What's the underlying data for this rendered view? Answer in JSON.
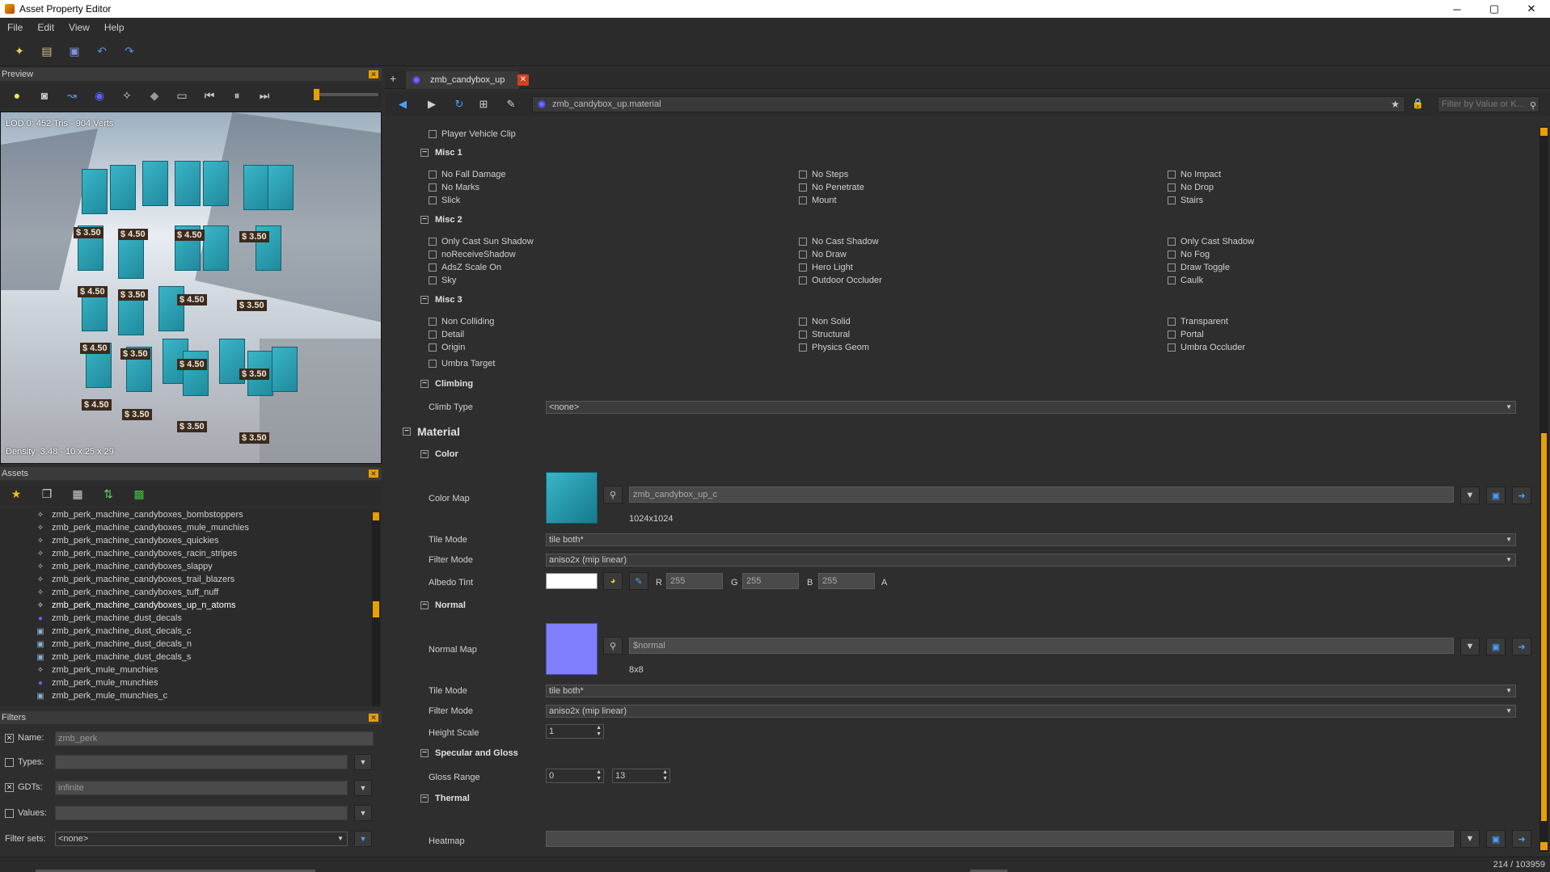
{
  "window": {
    "title": "Asset Property Editor",
    "controls": [
      "─",
      "▢",
      "✕"
    ]
  },
  "menu": [
    "File",
    "Edit",
    "View",
    "Help"
  ],
  "panels": {
    "preview": "Preview",
    "assets": "Assets",
    "filters": "Filters"
  },
  "preview": {
    "lod_stat": "LOD 0: 452 Tris - 904 Verts",
    "density": "Density: 3.48 - 10 x 25 x 29",
    "prices": [
      "$ 3.50",
      "$ 4.50",
      "$ 4.50",
      "$ 3.50",
      "$ 4.50",
      "$ 3.50",
      "$ 4.50",
      "$ 3.50",
      "$ 4.50",
      "$ 3.50",
      "$ 4.50",
      "$ 3.50",
      "$ 4.50",
      "$ 3.50",
      "$ 3.50",
      "$ 3.50"
    ]
  },
  "assets": [
    {
      "name": "zmb_perk_machine_candyboxes_bombstoppers",
      "icon": "model"
    },
    {
      "name": "zmb_perk_machine_candyboxes_mule_munchies",
      "icon": "model"
    },
    {
      "name": "zmb_perk_machine_candyboxes_quickies",
      "icon": "model"
    },
    {
      "name": "zmb_perk_machine_candyboxes_racin_stripes",
      "icon": "model"
    },
    {
      "name": "zmb_perk_machine_candyboxes_slappy",
      "icon": "model"
    },
    {
      "name": "zmb_perk_machine_candyboxes_trail_blazers",
      "icon": "model"
    },
    {
      "name": "zmb_perk_machine_candyboxes_tuff_nuff",
      "icon": "model"
    },
    {
      "name": "zmb_perk_machine_candyboxes_up_n_atoms",
      "icon": "model"
    },
    {
      "name": "zmb_perk_machine_dust_decals",
      "icon": "material"
    },
    {
      "name": "zmb_perk_machine_dust_decals_c",
      "icon": "image"
    },
    {
      "name": "zmb_perk_machine_dust_decals_n",
      "icon": "image"
    },
    {
      "name": "zmb_perk_machine_dust_decals_s",
      "icon": "image"
    },
    {
      "name": "zmb_perk_mule_munchies",
      "icon": "model"
    },
    {
      "name": "zmb_perk_mule_munchies",
      "icon": "material"
    },
    {
      "name": "zmb_perk_mule_munchies_c",
      "icon": "image"
    }
  ],
  "filters": {
    "name_label": "Name:",
    "name_value": "zmb_perk",
    "name_checked": "✕",
    "types_label": "Types:",
    "types_value": "",
    "gdts_label": "GDTs:",
    "gdts_value": "infinite",
    "gdts_checked": "✕",
    "values_label": "Values:",
    "values_value": "",
    "sets_label": "Filter sets:",
    "sets_value": "<none>"
  },
  "tab": {
    "add": "+",
    "label": "zmb_candybox_up",
    "close": "✕"
  },
  "address": {
    "path": "zmb_candybox_up.material",
    "filter_placeholder": "Filter by Value or K..."
  },
  "props": {
    "player_vehicle_clip": "Player Vehicle Clip",
    "misc1": {
      "title": "Misc 1",
      "col1": [
        "No Fall Damage",
        "No Marks",
        "Slick"
      ],
      "col2": [
        "No Steps",
        "No Penetrate",
        "Mount"
      ],
      "col3": [
        "No Impact",
        "No Drop",
        "Stairs"
      ]
    },
    "misc2": {
      "title": "Misc 2",
      "col1": [
        "Only Cast Sun Shadow",
        "noReceiveShadow",
        "AdsZ Scale On",
        "Sky"
      ],
      "col2": [
        "No Cast Shadow",
        "No Draw",
        "Hero Light",
        "Outdoor Occluder"
      ],
      "col3": [
        "Only Cast Shadow",
        "No Fog",
        "Draw Toggle",
        "Caulk"
      ]
    },
    "misc3": {
      "title": "Misc 3",
      "col1": [
        "Non Colliding",
        "Detail",
        "Origin"
      ],
      "col2": [
        "Non Solid",
        "Structural",
        "Physics Geom"
      ],
      "col3": [
        "Transparent",
        "Portal",
        "Umbra Occluder"
      ],
      "extra": "Umbra Target"
    },
    "climbing": {
      "title": "Climbing",
      "label": "Climb Type",
      "value": "<none>"
    },
    "material": {
      "title": "Material"
    },
    "color": {
      "title": "Color",
      "map_label": "Color Map",
      "map_value": "zmb_candybox_up_c",
      "map_size": "1024x1024",
      "tile_label": "Tile Mode",
      "tile_value": "tile both*",
      "filter_label": "Filter Mode",
      "filter_value": "aniso2x (mip linear)",
      "albedo_label": "Albedo Tint",
      "r_label": "R",
      "r": "255",
      "g_label": "G",
      "g": "255",
      "b_label": "B",
      "b": "255",
      "a_label": "A"
    },
    "normal": {
      "title": "Normal",
      "map_label": "Normal Map",
      "map_value": "$normal",
      "map_size": "8x8",
      "tile_label": "Tile Mode",
      "tile_value": "tile both*",
      "filter_label": "Filter Mode",
      "filter_value": "aniso2x (mip linear)",
      "height_label": "Height Scale",
      "height_value": "1"
    },
    "specular": {
      "title": "Specular and Gloss",
      "gloss_label": "Gloss Range",
      "gloss_min": "0",
      "gloss_max": "13"
    },
    "thermal": {
      "title": "Thermal",
      "heatmap_label": "Heatmap",
      "heatmap_value": ""
    }
  },
  "status": {
    "count": "214 / 103959"
  },
  "colors": {
    "accent": "#e8a000",
    "normal_swatch": "#8080ff",
    "albedo": "#ffffff"
  }
}
